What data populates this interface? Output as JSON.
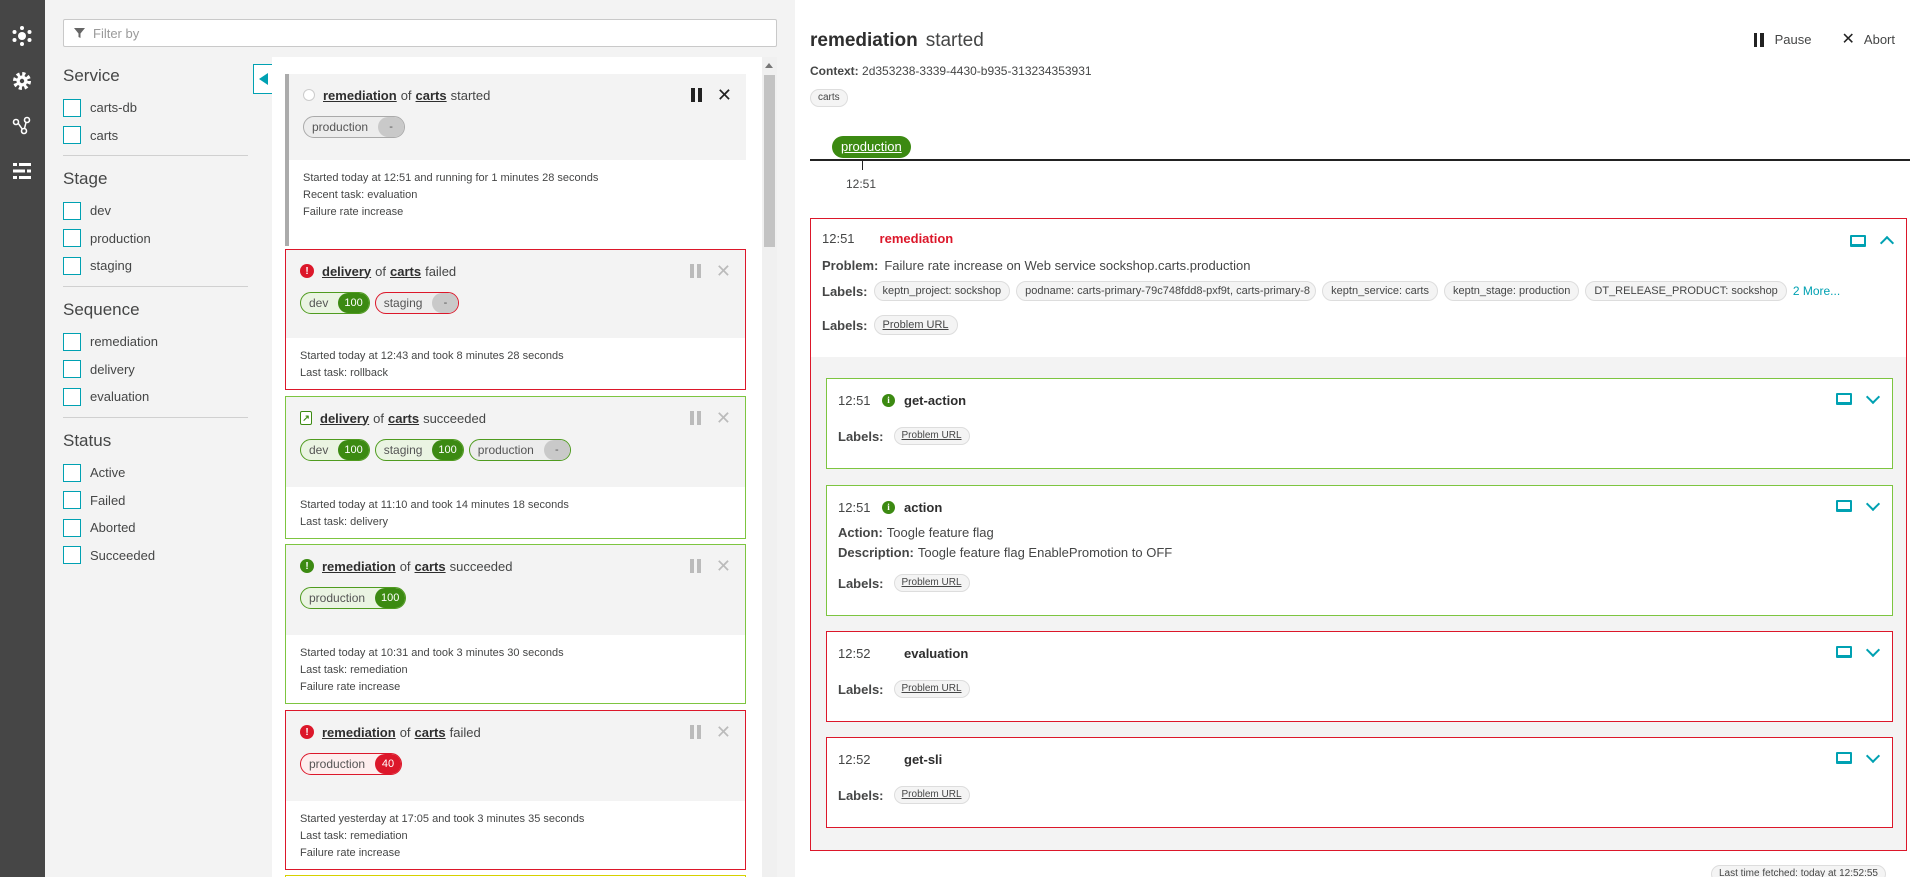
{
  "nav": {
    "items": [
      {
        "icon": "keptn-logo-icon"
      },
      {
        "icon": "gear-icon"
      },
      {
        "icon": "services-icon"
      },
      {
        "icon": "sequences-icon"
      }
    ]
  },
  "filter": {
    "placeholder": "Filter by",
    "groups": [
      {
        "title": "Service",
        "options": [
          "carts-db",
          "carts"
        ]
      },
      {
        "title": "Stage",
        "options": [
          "dev",
          "production",
          "staging"
        ]
      },
      {
        "title": "Sequence",
        "options": [
          "remediation",
          "delivery",
          "evaluation"
        ]
      },
      {
        "title": "Status",
        "options": [
          "Active",
          "Failed",
          "Aborted",
          "Succeeded"
        ]
      }
    ]
  },
  "sequences": [
    {
      "name": "remediation",
      "of": "of",
      "service": "carts",
      "status": "started",
      "stages": [
        {
          "name": "production",
          "value": "-"
        }
      ],
      "lines": [
        "Started today at 12:51 and running for 1 minutes 28 seconds",
        "Recent task: evaluation",
        "Failure rate increase"
      ]
    },
    {
      "name": "delivery",
      "of": "of",
      "service": "carts",
      "status": "failed",
      "stages": [
        {
          "name": "dev",
          "value": "100"
        },
        {
          "name": "staging",
          "value": "-"
        }
      ],
      "lines": [
        "Started today at 12:43 and took 8 minutes 28 seconds",
        "Last task: rollback"
      ]
    },
    {
      "name": "delivery",
      "of": "of",
      "service": "carts",
      "status": "succeeded",
      "stages": [
        {
          "name": "dev",
          "value": "100"
        },
        {
          "name": "staging",
          "value": "100"
        },
        {
          "name": "production",
          "value": "-"
        }
      ],
      "lines": [
        "Started today at 11:10 and took 14 minutes 18 seconds",
        "Last task: delivery"
      ]
    },
    {
      "name": "remediation",
      "of": "of",
      "service": "carts",
      "status": "succeeded",
      "stages": [
        {
          "name": "production",
          "value": "100"
        }
      ],
      "lines": [
        "Started today at 10:31 and took 3 minutes 30 seconds",
        "Last task: remediation",
        "Failure rate increase"
      ]
    },
    {
      "name": "remediation",
      "of": "of",
      "service": "carts",
      "status": "failed",
      "stages": [
        {
          "name": "production",
          "value": "40"
        }
      ],
      "lines": [
        "Started yesterday at 17:05 and took 3 minutes 35 seconds",
        "Last task: remediation",
        "Failure rate increase"
      ]
    }
  ],
  "detail": {
    "title": "remediation",
    "status": "started",
    "pause_label": "Pause",
    "abort_label": "Abort",
    "context_label": "Context:",
    "context_id": "2d353238-3339-4430-b935-313234353931",
    "service_tag": "carts",
    "timeline": {
      "stage": "production",
      "time": "12:51"
    },
    "root_task": {
      "time": "12:51",
      "name": "remediation",
      "problem_label": "Problem:",
      "problem": "Failure rate increase on Web service sockshop.carts.production",
      "labels_label": "Labels:",
      "labels": [
        "keptn_project: sockshop",
        "podname: carts-primary-79c748fdd8-pxf9t, carts-primary-8",
        "keptn_service: carts",
        "keptn_stage: production",
        "DT_RELEASE_PRODUCT: sockshop"
      ],
      "more": "2 More...",
      "links_label": "Labels:",
      "link": "Problem URL"
    },
    "subtasks": [
      {
        "time": "12:51",
        "name": "get-action",
        "labels_label": "Labels:",
        "link": "Problem URL"
      },
      {
        "time": "12:51",
        "name": "action",
        "action_label": "Action:",
        "action": "Toogle feature flag",
        "description_label": "Description:",
        "description": "Toogle feature flag EnablePromotion to OFF",
        "labels_label": "Labels:",
        "link": "Problem URL"
      },
      {
        "time": "12:52",
        "name": "evaluation",
        "labels_label": "Labels:",
        "link": "Problem URL"
      },
      {
        "time": "12:52",
        "name": "get-sli",
        "labels_label": "Labels:",
        "link": "Problem URL"
      }
    ],
    "last_fetched": "Last time fetched: today at 12:52:55"
  },
  "colors": {
    "accent": "#00a1b2",
    "success": "#3c8a12",
    "error": "#dc172a",
    "rail": "#464646"
  }
}
